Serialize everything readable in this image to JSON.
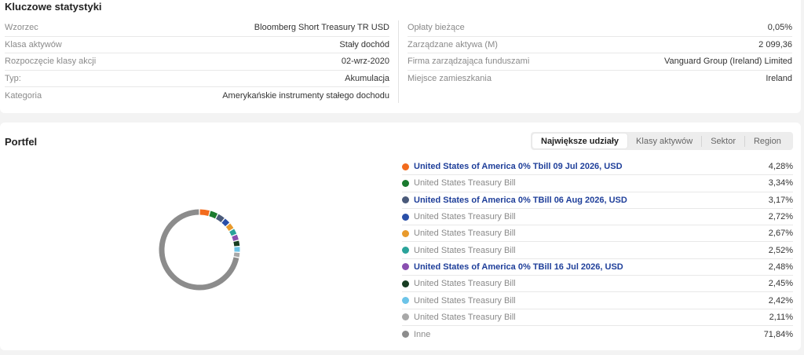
{
  "stats": {
    "title": "Kluczowe statystyki",
    "left": [
      {
        "label": "Wzorzec",
        "value": "Bloomberg Short Treasury TR USD"
      },
      {
        "label": "Klasa aktywów",
        "value": "Stały dochód"
      },
      {
        "label": "Rozpoczęcie klasy akcji",
        "value": "02-wrz-2020"
      },
      {
        "label": "Typ:",
        "value": "Akumulacja"
      },
      {
        "label": "Kategoria",
        "value": "Amerykańskie instrumenty stałego dochodu"
      }
    ],
    "right": [
      {
        "label": "Opłaty bieżące",
        "value": "0,05%"
      },
      {
        "label": "Zarządzane aktywa (M)",
        "value": "2 099,36"
      },
      {
        "label": "Firma zarządzająca funduszami",
        "value": "Vanguard Group (Ireland) Limited"
      },
      {
        "label": "Miejsce zamieszkania",
        "value": "Ireland"
      }
    ]
  },
  "portfolio": {
    "title": "Portfel",
    "tabs": [
      {
        "label": "Największe udziały",
        "active": true
      },
      {
        "label": "Klasy aktywów",
        "active": false
      },
      {
        "label": "Sektor",
        "active": false
      },
      {
        "label": "Region",
        "active": false
      }
    ],
    "holdings": [
      {
        "name": "United States of America 0% Tbill 09 Jul 2026, USD",
        "pct": "4,28%",
        "value": 4.28,
        "color": "#f26b1d",
        "link": true
      },
      {
        "name": "United States Treasury Bill",
        "pct": "3,34%",
        "value": 3.34,
        "color": "#1a7a2e",
        "link": false
      },
      {
        "name": "United States of America 0% TBill 06 Aug 2026, USD",
        "pct": "3,17%",
        "value": 3.17,
        "color": "#4a5a7a",
        "link": true
      },
      {
        "name": "United States Treasury Bill",
        "pct": "2,72%",
        "value": 2.72,
        "color": "#2a4fa8",
        "link": false
      },
      {
        "name": "United States Treasury Bill",
        "pct": "2,67%",
        "value": 2.67,
        "color": "#e89a2c",
        "link": false
      },
      {
        "name": "United States Treasury Bill",
        "pct": "2,52%",
        "value": 2.52,
        "color": "#2aa39a",
        "link": false
      },
      {
        "name": "United States of America 0% TBill 16 Jul 2026, USD",
        "pct": "2,48%",
        "value": 2.48,
        "color": "#8a4fb0",
        "link": true
      },
      {
        "name": "United States Treasury Bill",
        "pct": "2,45%",
        "value": 2.45,
        "color": "#173d22",
        "link": false
      },
      {
        "name": "United States Treasury Bill",
        "pct": "2,42%",
        "value": 2.42,
        "color": "#6cc4e8",
        "link": false
      },
      {
        "name": "United States Treasury Bill",
        "pct": "2,11%",
        "value": 2.11,
        "color": "#a8a8a8",
        "link": false
      },
      {
        "name": "Inne",
        "pct": "71,84%",
        "value": 71.84,
        "color": "#8c8c8c",
        "link": false
      }
    ]
  }
}
